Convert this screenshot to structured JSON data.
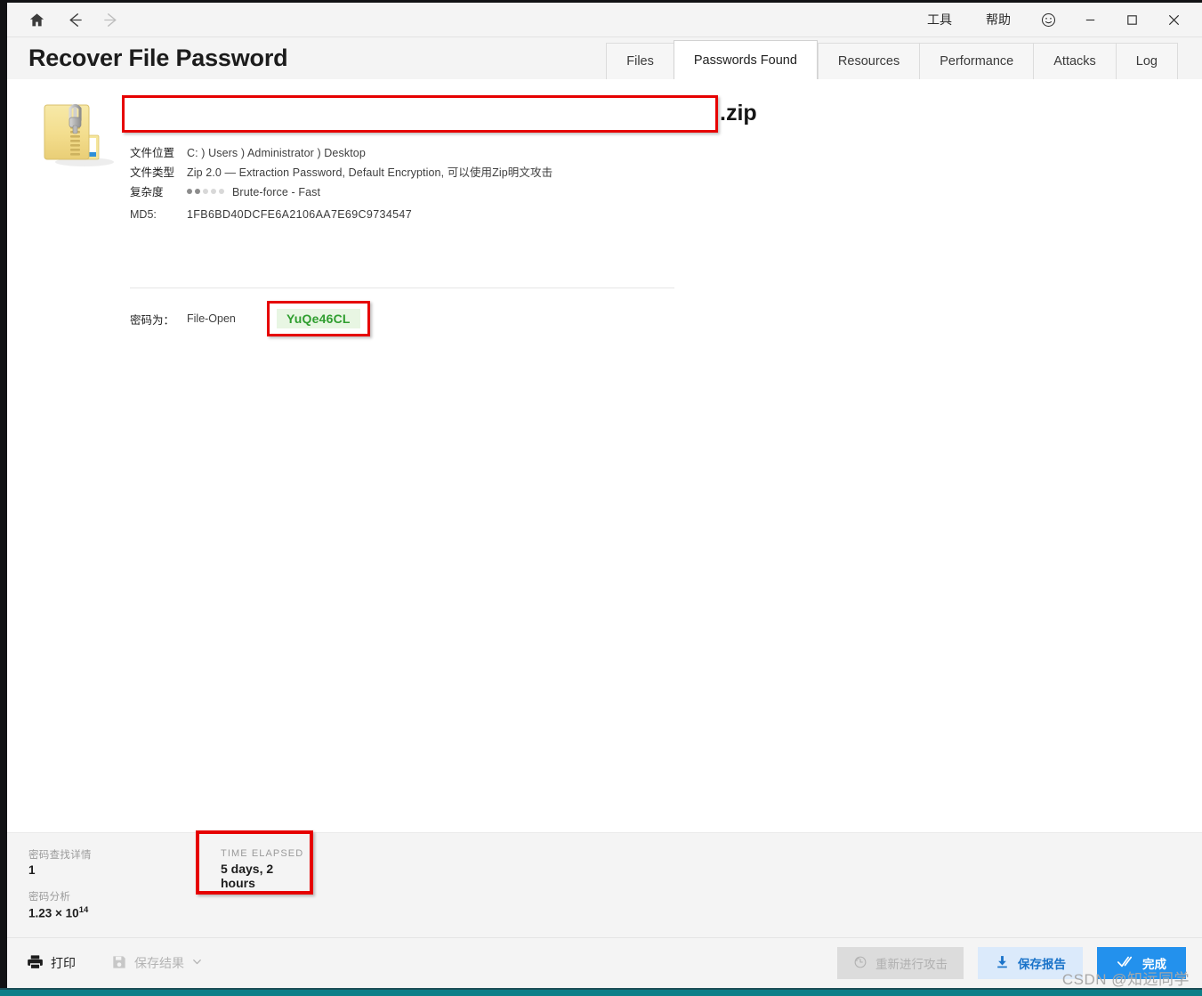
{
  "window": {
    "nav": {
      "home_icon": "home-icon",
      "back_icon": "back-arrow-icon",
      "forward_icon": "forward-arrow-icon"
    },
    "menu": [
      "工具",
      "帮助"
    ],
    "smiley_icon": "smiley-icon",
    "minimize_icon": "minimize-icon",
    "maximize_icon": "maximize-icon",
    "close_icon": "close-icon"
  },
  "header": {
    "title": "Recover File Password",
    "tabs": [
      {
        "label": "Files",
        "active": false
      },
      {
        "label": "Passwords Found",
        "active": true
      },
      {
        "label": "Resources",
        "active": false
      },
      {
        "label": "Performance",
        "active": false
      },
      {
        "label": "Attacks",
        "active": false
      },
      {
        "label": "Log",
        "active": false
      }
    ]
  },
  "file": {
    "icon": "zip-file-icon",
    "name_redacted": "",
    "extension": ".zip",
    "meta": [
      {
        "label": "文件位置",
        "value": "C: ) Users ) Administrator ) Desktop"
      },
      {
        "label": "文件类型",
        "value": "Zip 2.0 — Extraction Password, Default Encryption, 可以使用Zip明文攻击"
      }
    ],
    "complexity": {
      "label": "复杂度",
      "dots_filled": 2,
      "dots_total": 5,
      "value": "Brute-force - Fast"
    },
    "md5": {
      "label": "MD5:",
      "value": "1FB6BD40DCFE6A2106AA7E69C9734547"
    }
  },
  "password": {
    "label": "密码为：",
    "kind": "File-Open",
    "value": "YuQe46CL",
    "value_color": "#2f9e2f",
    "value_bg": "#e8f6e3"
  },
  "stats": {
    "found": {
      "label": "密码查找详情",
      "value": "1"
    },
    "analysis": {
      "label": "密码分析",
      "value": "1.23 × 10",
      "exponent": "14"
    },
    "elapsed": {
      "label": "TIME ELAPSED",
      "value": "5 days, 2 hours"
    }
  },
  "actions": {
    "print": {
      "label": "打印",
      "icon": "printer-icon"
    },
    "save_results": {
      "label": "保存结果",
      "icon": "floppy-disk-icon",
      "chevron": "chevron-down-icon"
    },
    "restart_attack": {
      "label": "重新进行攻击",
      "icon": "refresh-icon",
      "disabled": true
    },
    "save_report": {
      "label": "保存报告",
      "icon": "download-icon"
    },
    "finish": {
      "label": "完成",
      "icon": "double-check-icon"
    }
  },
  "watermark": "CSDN @知远同学",
  "highlight_color": "#e60000"
}
